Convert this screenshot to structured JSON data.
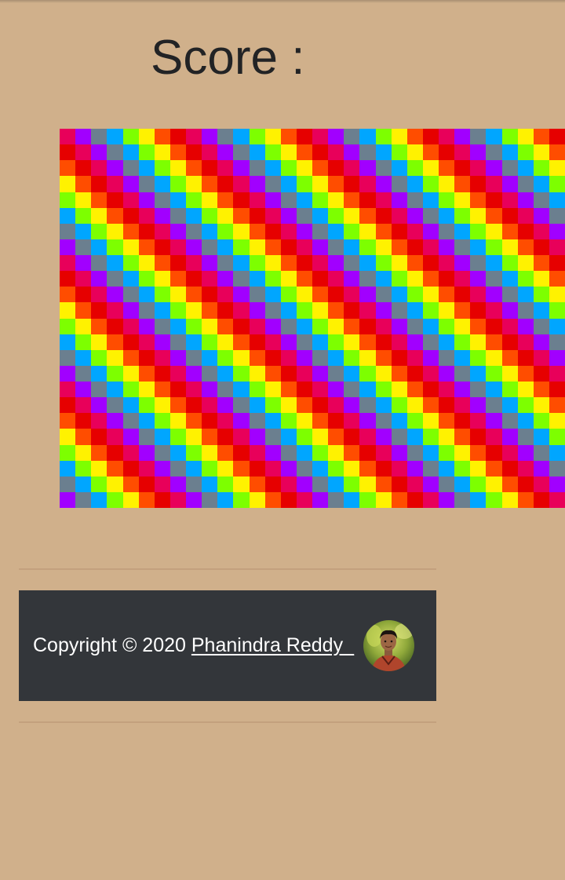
{
  "header": {
    "score_label": "Score :",
    "score_value": ""
  },
  "board": {
    "palette": [
      "#e8005a",
      "#a100ff",
      "#6b7f8f",
      "#00a6ff",
      "#7dff00",
      "#fff200",
      "#ff4d00",
      "#e60000"
    ]
  },
  "footer": {
    "copyright_prefix": "Copyright © 2020 ",
    "author_name": "Phanindra Reddy_",
    "avatar_icon": "author-avatar"
  },
  "colors": {
    "page_background": "#d0b08b",
    "footer_background": "#33363a",
    "footer_text": "#ffffff",
    "divider": "#c3a07d"
  }
}
